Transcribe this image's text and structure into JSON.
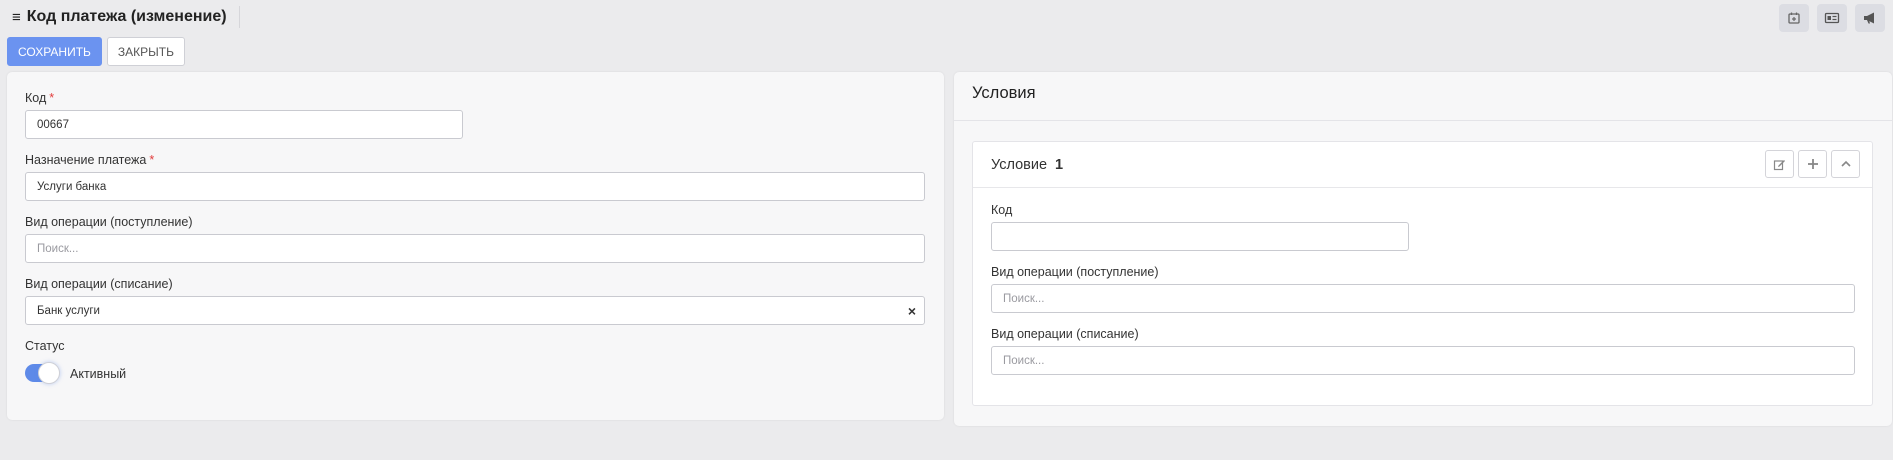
{
  "header": {
    "title": "Код платежа (изменение)",
    "icons": [
      "calendar-icon",
      "id-card-icon",
      "megaphone-icon"
    ]
  },
  "toolbar": {
    "save_label": "СОХРАНИТЬ",
    "close_label": "ЗАКРЫТЬ"
  },
  "form": {
    "code": {
      "label": "Код",
      "required": "*",
      "value": "00667"
    },
    "purpose": {
      "label": "Назначение платежа",
      "required": "*",
      "value": "Услуги банка"
    },
    "op_income": {
      "label": "Вид операции (поступление)",
      "placeholder": "Поиск..."
    },
    "op_expense": {
      "label": "Вид операции (списание)",
      "value": "Банк услуги",
      "clear": "×"
    },
    "status": {
      "label": "Статус",
      "toggle_label": "Активный",
      "active": true
    }
  },
  "conditions": {
    "title": "Условия",
    "items": [
      {
        "title": "Условие",
        "number": "1",
        "code_label": "Код",
        "code_value": "",
        "op_income_label": "Вид операции (поступление)",
        "op_income_placeholder": "Поиск...",
        "op_expense_label": "Вид операции (списание)",
        "op_expense_placeholder": "Поиск..."
      }
    ]
  },
  "colors": {
    "primary": "#6b93f0",
    "toggle": "#5e8ae8",
    "required": "#e23b3b",
    "background": "#ebebed"
  }
}
